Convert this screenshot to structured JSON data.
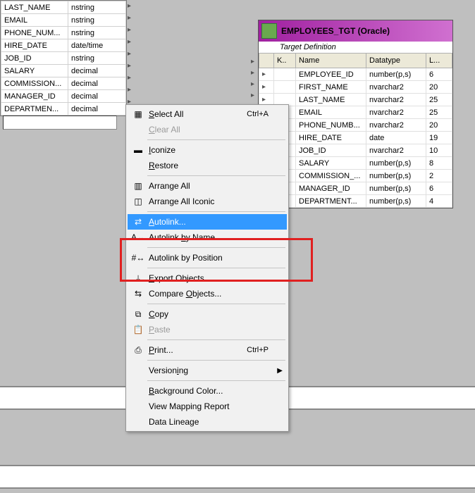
{
  "source": {
    "rows": [
      {
        "name": "LAST_NAME",
        "type": "nstring"
      },
      {
        "name": "EMAIL",
        "type": "nstring"
      },
      {
        "name": "PHONE_NUM...",
        "type": "nstring"
      },
      {
        "name": "HIRE_DATE",
        "type": "date/time"
      },
      {
        "name": "JOB_ID",
        "type": "nstring"
      },
      {
        "name": "SALARY",
        "type": "decimal"
      },
      {
        "name": "COMMISSION...",
        "type": "decimal"
      },
      {
        "name": "MANAGER_ID",
        "type": "decimal"
      },
      {
        "name": "DEPARTMEN...",
        "type": "decimal"
      }
    ]
  },
  "target": {
    "title": "EMPLOYEES_TGT (Oracle)",
    "subtitle": "Target Definition",
    "headers": {
      "k": "K..",
      "name": "Name",
      "datatype": "Datatype",
      "len": "L..."
    },
    "rows": [
      {
        "name": "EMPLOYEE_ID",
        "datatype": "number(p,s)",
        "len": "6"
      },
      {
        "name": "FIRST_NAME",
        "datatype": "nvarchar2",
        "len": "20"
      },
      {
        "name": "LAST_NAME",
        "datatype": "nvarchar2",
        "len": "25"
      },
      {
        "name": "EMAIL",
        "datatype": "nvarchar2",
        "len": "25"
      },
      {
        "name": "PHONE_NUMB...",
        "datatype": "nvarchar2",
        "len": "20"
      },
      {
        "name": "HIRE_DATE",
        "datatype": "date",
        "len": "19"
      },
      {
        "name": "JOB_ID",
        "datatype": "nvarchar2",
        "len": "10"
      },
      {
        "name": "SALARY",
        "datatype": "number(p,s)",
        "len": "8"
      },
      {
        "name": "COMMISSION_...",
        "datatype": "number(p,s)",
        "len": "2"
      },
      {
        "name": "MANAGER_ID",
        "datatype": "number(p,s)",
        "len": "6"
      },
      {
        "name": "DEPARTMENT...",
        "datatype": "number(p,s)",
        "len": "4"
      }
    ]
  },
  "menu": [
    {
      "kind": "item",
      "label": "Select All",
      "u": 0,
      "shortcut": "Ctrl+A",
      "icon": "select-all-icon",
      "name": "menu-select-all"
    },
    {
      "kind": "item",
      "label": "Clear All",
      "u": 0,
      "disabled": true,
      "name": "menu-clear-all"
    },
    {
      "kind": "sep"
    },
    {
      "kind": "item",
      "label": "Iconize",
      "u": 0,
      "icon": "iconize-icon",
      "name": "menu-iconize"
    },
    {
      "kind": "item",
      "label": "Restore",
      "u": 0,
      "name": "menu-restore"
    },
    {
      "kind": "sep"
    },
    {
      "kind": "item",
      "label": "Arrange All",
      "icon": "arrange-icon",
      "name": "menu-arrange-all"
    },
    {
      "kind": "item",
      "label": "Arrange All Iconic",
      "icon": "arrange-iconic-icon",
      "name": "menu-arrange-all-iconic"
    },
    {
      "kind": "sep"
    },
    {
      "kind": "item",
      "label": "Autolink...",
      "u": 0,
      "hover": true,
      "icon": "autolink-icon",
      "name": "menu-autolink"
    },
    {
      "kind": "item",
      "label": "Autolink by Name",
      "u": 9,
      "icon": "autolink-name-icon",
      "name": "menu-autolink-by-name"
    },
    {
      "kind": "sep"
    },
    {
      "kind": "item",
      "label": "Autolink by Position",
      "icon": "autolink-pos-icon",
      "name": "menu-autolink-by-position"
    },
    {
      "kind": "sep"
    },
    {
      "kind": "item",
      "label": "Export Objects...",
      "u": 0,
      "icon": "export-icon",
      "name": "menu-export-objects"
    },
    {
      "kind": "item",
      "label": "Compare Objects...",
      "u": 8,
      "icon": "compare-icon",
      "name": "menu-compare-objects"
    },
    {
      "kind": "sep"
    },
    {
      "kind": "item",
      "label": "Copy",
      "u": 0,
      "icon": "copy-icon",
      "name": "menu-copy"
    },
    {
      "kind": "item",
      "label": "Paste",
      "u": 0,
      "disabled": true,
      "icon": "paste-icon",
      "name": "menu-paste"
    },
    {
      "kind": "sep"
    },
    {
      "kind": "item",
      "label": "Print...",
      "u": 0,
      "shortcut": "Ctrl+P",
      "icon": "print-icon",
      "name": "menu-print"
    },
    {
      "kind": "sep"
    },
    {
      "kind": "item",
      "label": "Versioning",
      "u": 7,
      "submenu": true,
      "name": "menu-versioning"
    },
    {
      "kind": "sep"
    },
    {
      "kind": "item",
      "label": "Background Color...",
      "u": 0,
      "name": "menu-background-color"
    },
    {
      "kind": "item",
      "label": "View Mapping Report",
      "name": "menu-view-mapping-report"
    },
    {
      "kind": "item",
      "label": "Data Lineage",
      "name": "menu-data-lineage"
    }
  ]
}
